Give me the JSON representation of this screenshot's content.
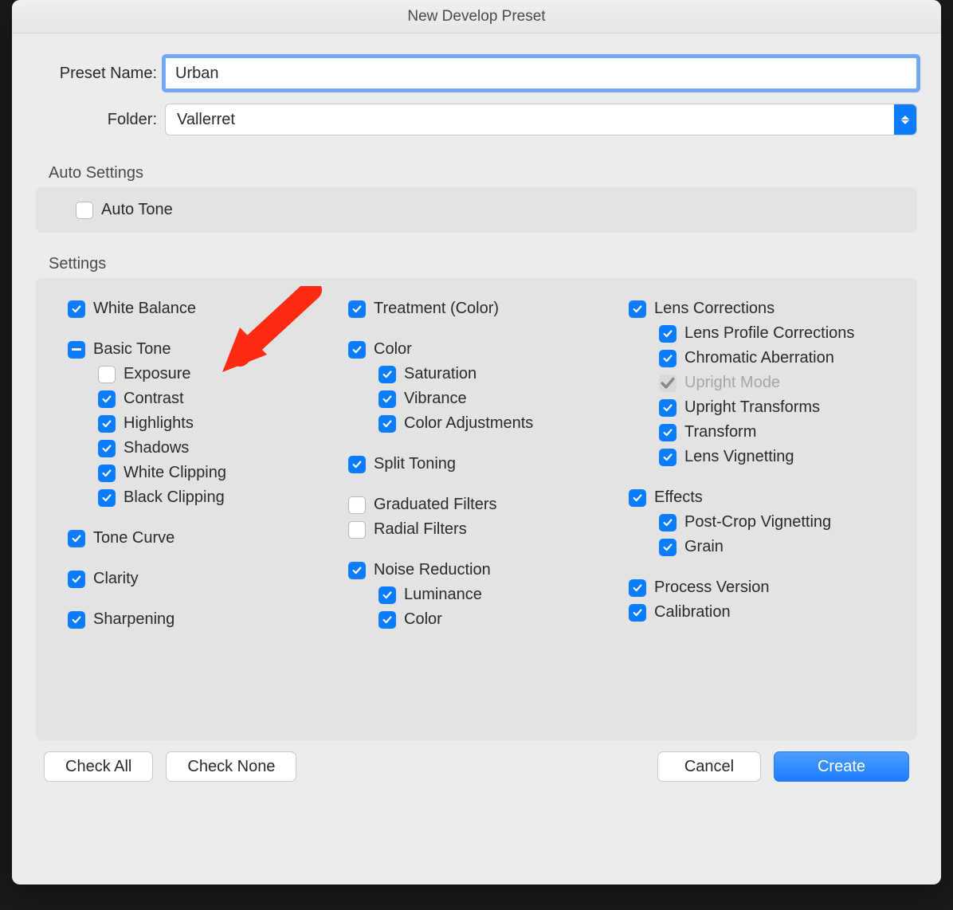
{
  "title": "New Develop Preset",
  "form": {
    "preset_name_label": "Preset Name:",
    "preset_name_value": "Urban",
    "folder_label": "Folder:",
    "folder_value": "Vallerret"
  },
  "sections": {
    "auto_settings_label": "Auto Settings",
    "auto_tone_label": "Auto Tone",
    "settings_label": "Settings"
  },
  "col1": {
    "white_balance": "White Balance",
    "basic_tone": "Basic Tone",
    "exposure": "Exposure",
    "contrast": "Contrast",
    "highlights": "Highlights",
    "shadows": "Shadows",
    "white_clipping": "White Clipping",
    "black_clipping": "Black Clipping",
    "tone_curve": "Tone Curve",
    "clarity": "Clarity",
    "sharpening": "Sharpening"
  },
  "col2": {
    "treatment": "Treatment (Color)",
    "color": "Color",
    "saturation": "Saturation",
    "vibrance": "Vibrance",
    "color_adjustments": "Color Adjustments",
    "split_toning": "Split Toning",
    "graduated_filters": "Graduated Filters",
    "radial_filters": "Radial Filters",
    "noise_reduction": "Noise Reduction",
    "luminance": "Luminance",
    "nr_color": "Color"
  },
  "col3": {
    "lens_corrections": "Lens Corrections",
    "lens_profile": "Lens Profile Corrections",
    "chromatic": "Chromatic Aberration",
    "upright_mode": "Upright Mode",
    "upright_transforms": "Upright Transforms",
    "transform": "Transform",
    "lens_vignetting": "Lens Vignetting",
    "effects": "Effects",
    "post_crop": "Post-Crop Vignetting",
    "grain": "Grain",
    "process_version": "Process Version",
    "calibration": "Calibration"
  },
  "buttons": {
    "check_all": "Check All",
    "check_none": "Check None",
    "cancel": "Cancel",
    "create": "Create"
  }
}
